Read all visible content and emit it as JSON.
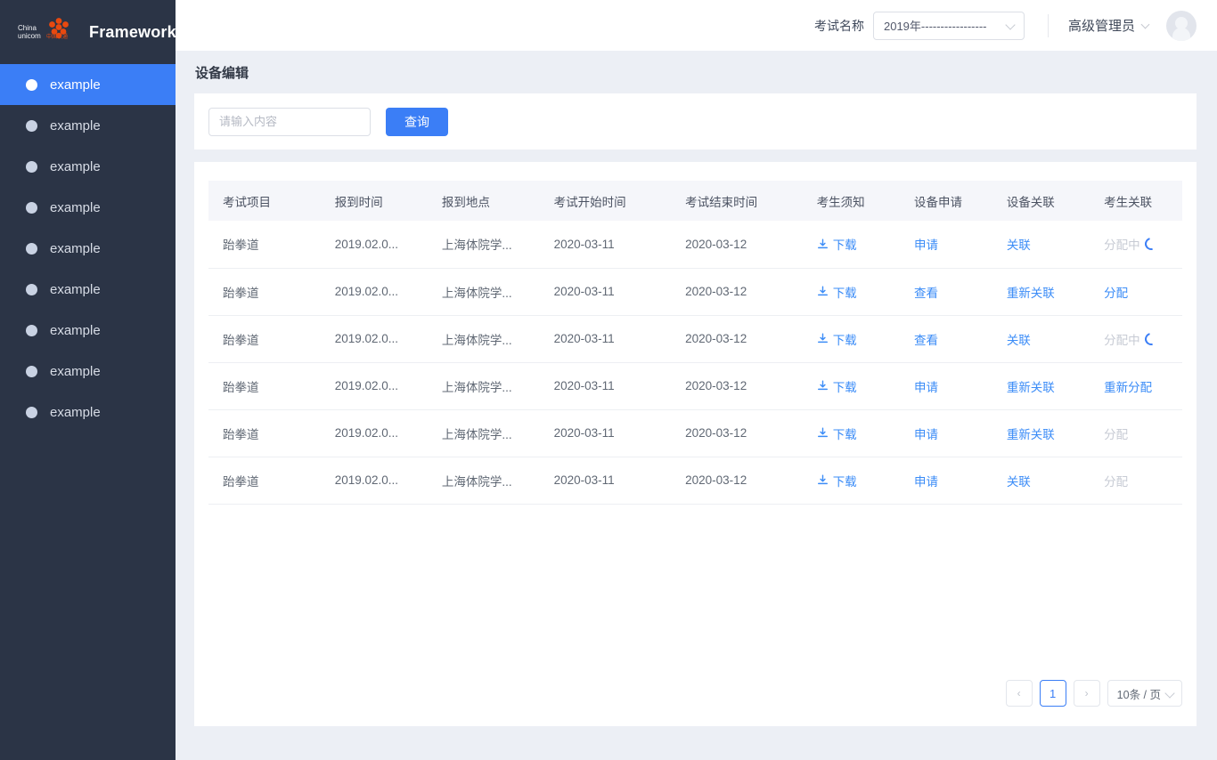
{
  "sidebar": {
    "logo_text": "Framework",
    "logo_brand_cn": "中国联通",
    "logo_brand_en": "China unicom",
    "items": [
      {
        "label": "example",
        "active": true
      },
      {
        "label": "example",
        "active": false
      },
      {
        "label": "example",
        "active": false
      },
      {
        "label": "example",
        "active": false
      },
      {
        "label": "example",
        "active": false
      },
      {
        "label": "example",
        "active": false
      },
      {
        "label": "example",
        "active": false
      },
      {
        "label": "example",
        "active": false
      },
      {
        "label": "example",
        "active": false
      }
    ]
  },
  "header": {
    "exam_label": "考试名称",
    "exam_select_value": "2019年-----------------",
    "user_name": "高级管理员"
  },
  "page": {
    "title": "设备编辑"
  },
  "search": {
    "placeholder": "请输入内容",
    "value": "",
    "button_label": "查询"
  },
  "table": {
    "columns": [
      "考试项目",
      "报到时间",
      "报到地点",
      "考试开始时间",
      "考试结束时间",
      "考生须知",
      "设备申请",
      "设备关联",
      "考生关联"
    ],
    "rows": [
      {
        "item": "跆拳道",
        "report_time": "2019.02.0...",
        "report_place": "上海体院学...",
        "start": "2020-03-11",
        "end": "2020-03-12",
        "notice": "下载",
        "apply": "申请",
        "device_link": "关联",
        "student_link": "分配中",
        "student_link_state": "loading"
      },
      {
        "item": "跆拳道",
        "report_time": "2019.02.0...",
        "report_place": "上海体院学...",
        "start": "2020-03-11",
        "end": "2020-03-12",
        "notice": "下载",
        "apply": "查看",
        "device_link": "重新关联",
        "student_link": "分配",
        "student_link_state": "link"
      },
      {
        "item": "跆拳道",
        "report_time": "2019.02.0...",
        "report_place": "上海体院学...",
        "start": "2020-03-11",
        "end": "2020-03-12",
        "notice": "下载",
        "apply": "查看",
        "device_link": "关联",
        "student_link": "分配中",
        "student_link_state": "loading"
      },
      {
        "item": "跆拳道",
        "report_time": "2019.02.0...",
        "report_place": "上海体院学...",
        "start": "2020-03-11",
        "end": "2020-03-12",
        "notice": "下载",
        "apply": "申请",
        "device_link": "重新关联",
        "student_link": "重新分配",
        "student_link_state": "link"
      },
      {
        "item": "跆拳道",
        "report_time": "2019.02.0...",
        "report_place": "上海体院学...",
        "start": "2020-03-11",
        "end": "2020-03-12",
        "notice": "下载",
        "apply": "申请",
        "device_link": "重新关联",
        "student_link": "分配",
        "student_link_state": "disabled"
      },
      {
        "item": "跆拳道",
        "report_time": "2019.02.0...",
        "report_place": "上海体院学...",
        "start": "2020-03-11",
        "end": "2020-03-12",
        "notice": "下载",
        "apply": "申请",
        "device_link": "关联",
        "student_link": "分配",
        "student_link_state": "disabled"
      }
    ]
  },
  "pagination": {
    "prev": "‹",
    "next": "›",
    "current_page": "1",
    "page_size": "10条 / 页"
  },
  "colors": {
    "accent": "#3b7ef6",
    "link": "#3b8cf7",
    "sidebar_bg": "#2b3446",
    "page_bg": "#eceff5",
    "brand_orange": "#e8490f"
  }
}
